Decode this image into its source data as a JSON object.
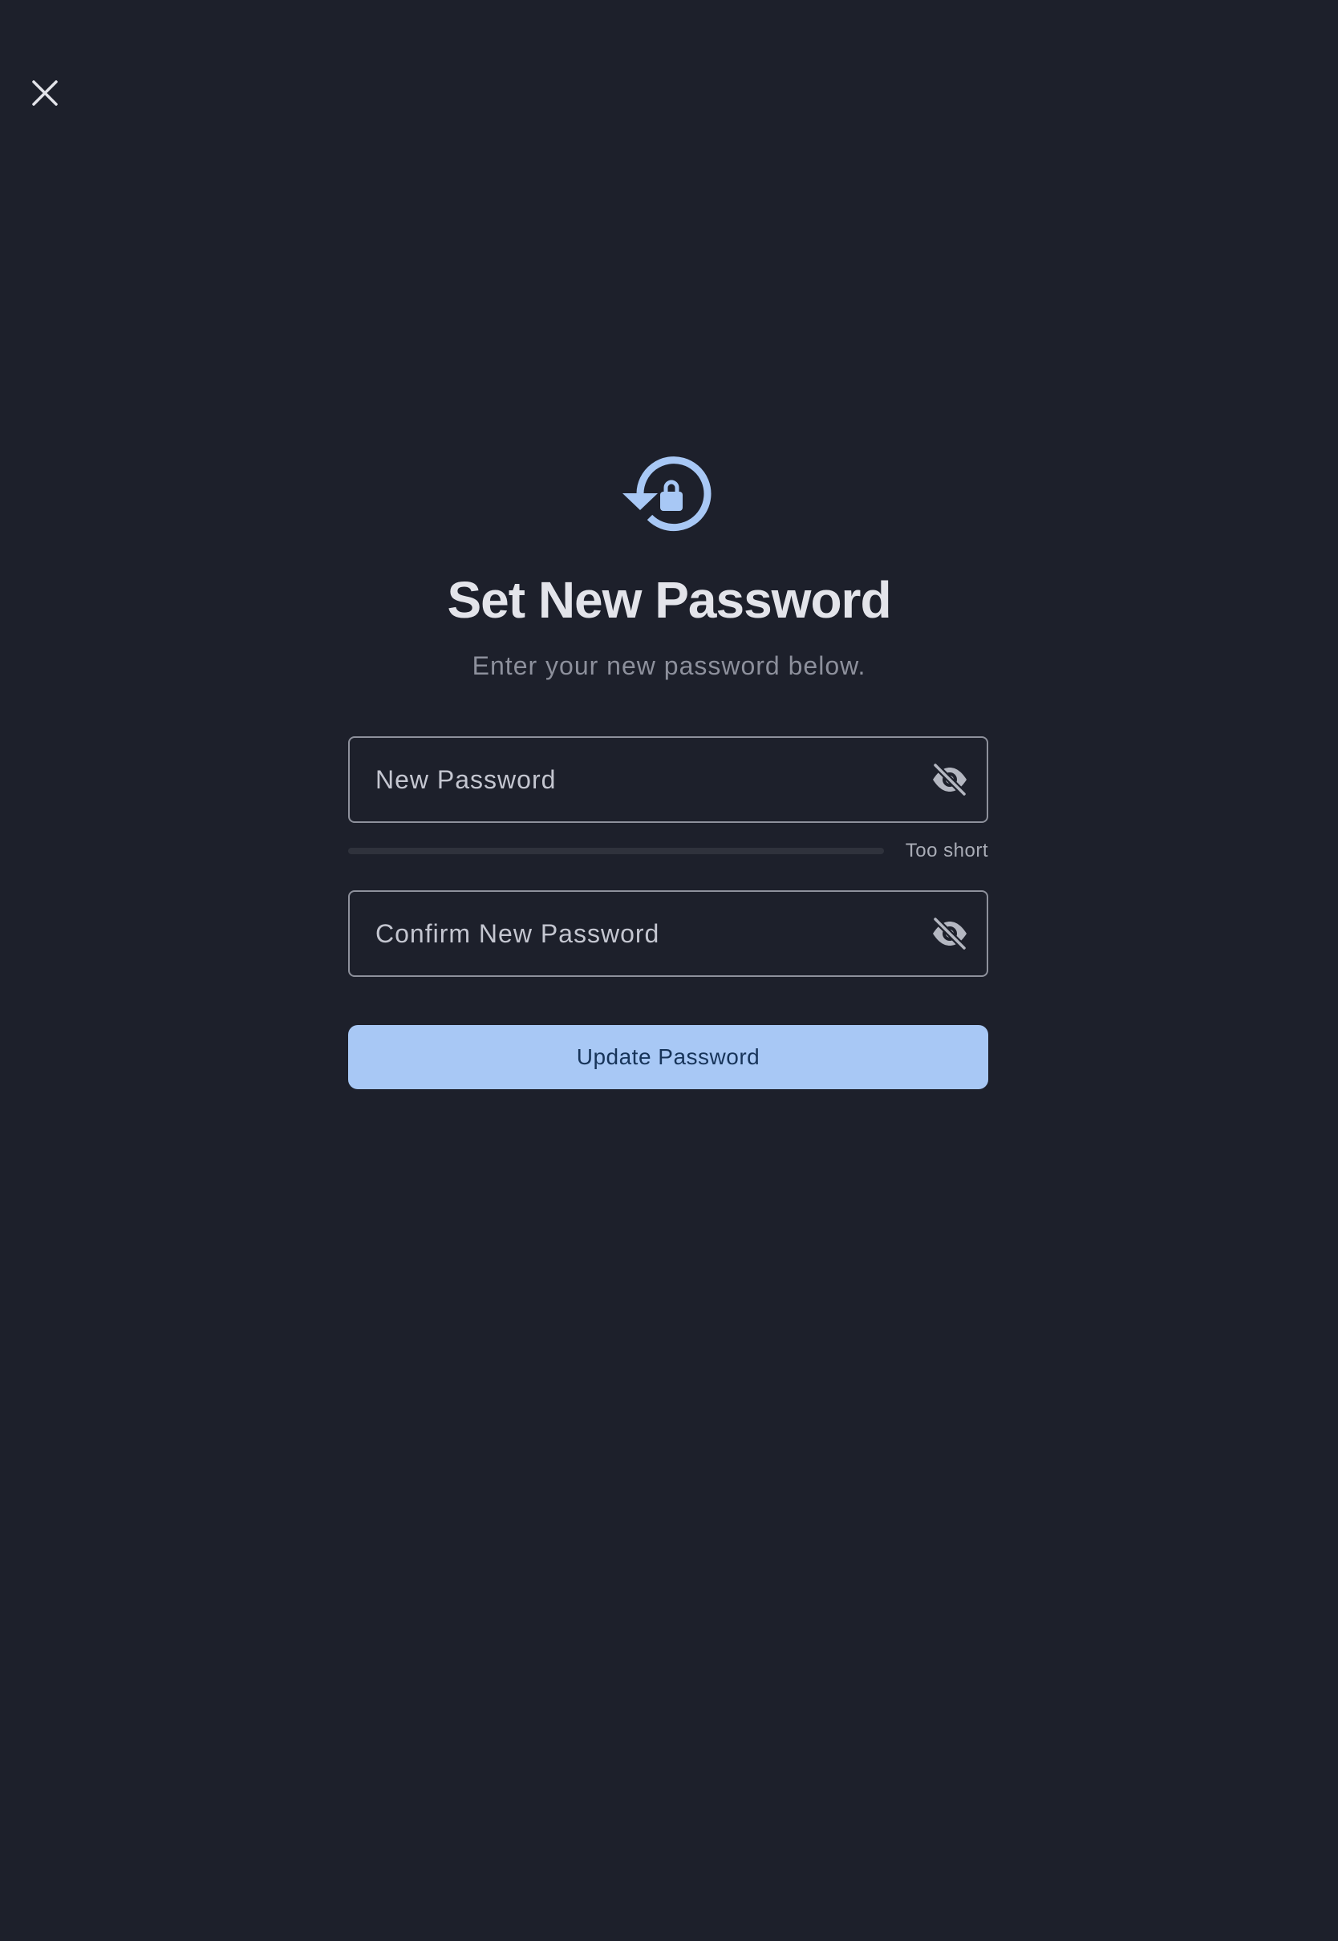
{
  "header": {
    "close_icon": "close-icon"
  },
  "hero": {
    "icon": "lock-reset-icon",
    "icon_color": "#a8c8f5",
    "title": "Set New Password",
    "subtitle": "Enter your new password below."
  },
  "form": {
    "new_password": {
      "label": "New Password",
      "value": "",
      "visibility_icon": "eye-off-icon"
    },
    "strength": {
      "label": "Too short",
      "level": 0
    },
    "confirm_password": {
      "label": "Confirm New Password",
      "value": "",
      "visibility_icon": "eye-off-icon"
    },
    "submit_label": "Update Password"
  },
  "colors": {
    "background": "#1d202b",
    "accent": "#a8c8f5",
    "button_text": "#173459"
  }
}
